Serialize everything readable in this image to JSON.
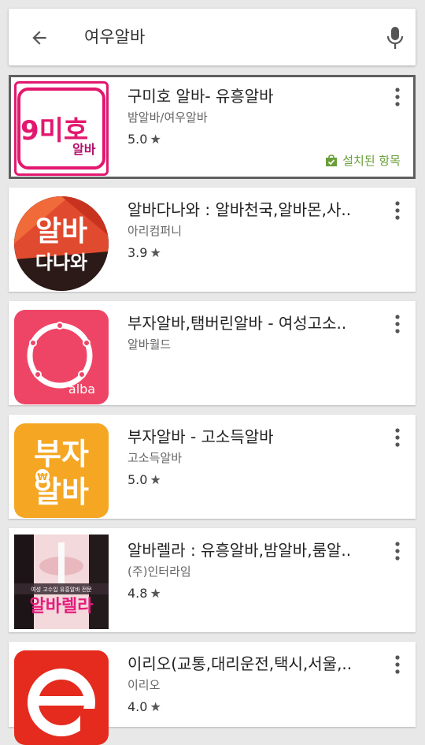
{
  "search": {
    "query": "여우알바"
  },
  "results": [
    {
      "title": "구미호 알바- 유흥알바",
      "developer": "밤알바/여우알바",
      "rating": "5.0",
      "installed_label": "설치된 항목",
      "icon_text": "9미호알바"
    },
    {
      "title": "알바다나와 : 알바천국,알바몬,사..",
      "developer": "아리컴퍼니",
      "rating": "3.9",
      "icon_line1": "알바",
      "icon_line2": "다나와"
    },
    {
      "title": "부자알바,탬버린알바 - 여성고소..",
      "developer": "알바월드",
      "rating": "",
      "icon_text": "alba"
    },
    {
      "title": "부자알바 - 고소득알바",
      "developer": "고소득알바",
      "rating": "5.0",
      "icon_line1": "부자",
      "icon_line2": "알바",
      "icon_coin": "₩"
    },
    {
      "title": "알바렐라 : 유흥알바,밤알바,룸알..",
      "developer": "(주)인터라임",
      "rating": "4.8",
      "icon_text": "알바렐라",
      "icon_small": "여성 고수입 유흥알바 전문"
    },
    {
      "title": "이리오(교통,대리운전,택시,서울,..",
      "developer": "이리오",
      "rating": "4.0"
    }
  ],
  "colors": {
    "installed_green": "#689f38",
    "selected_border": "#5f5f5f"
  }
}
